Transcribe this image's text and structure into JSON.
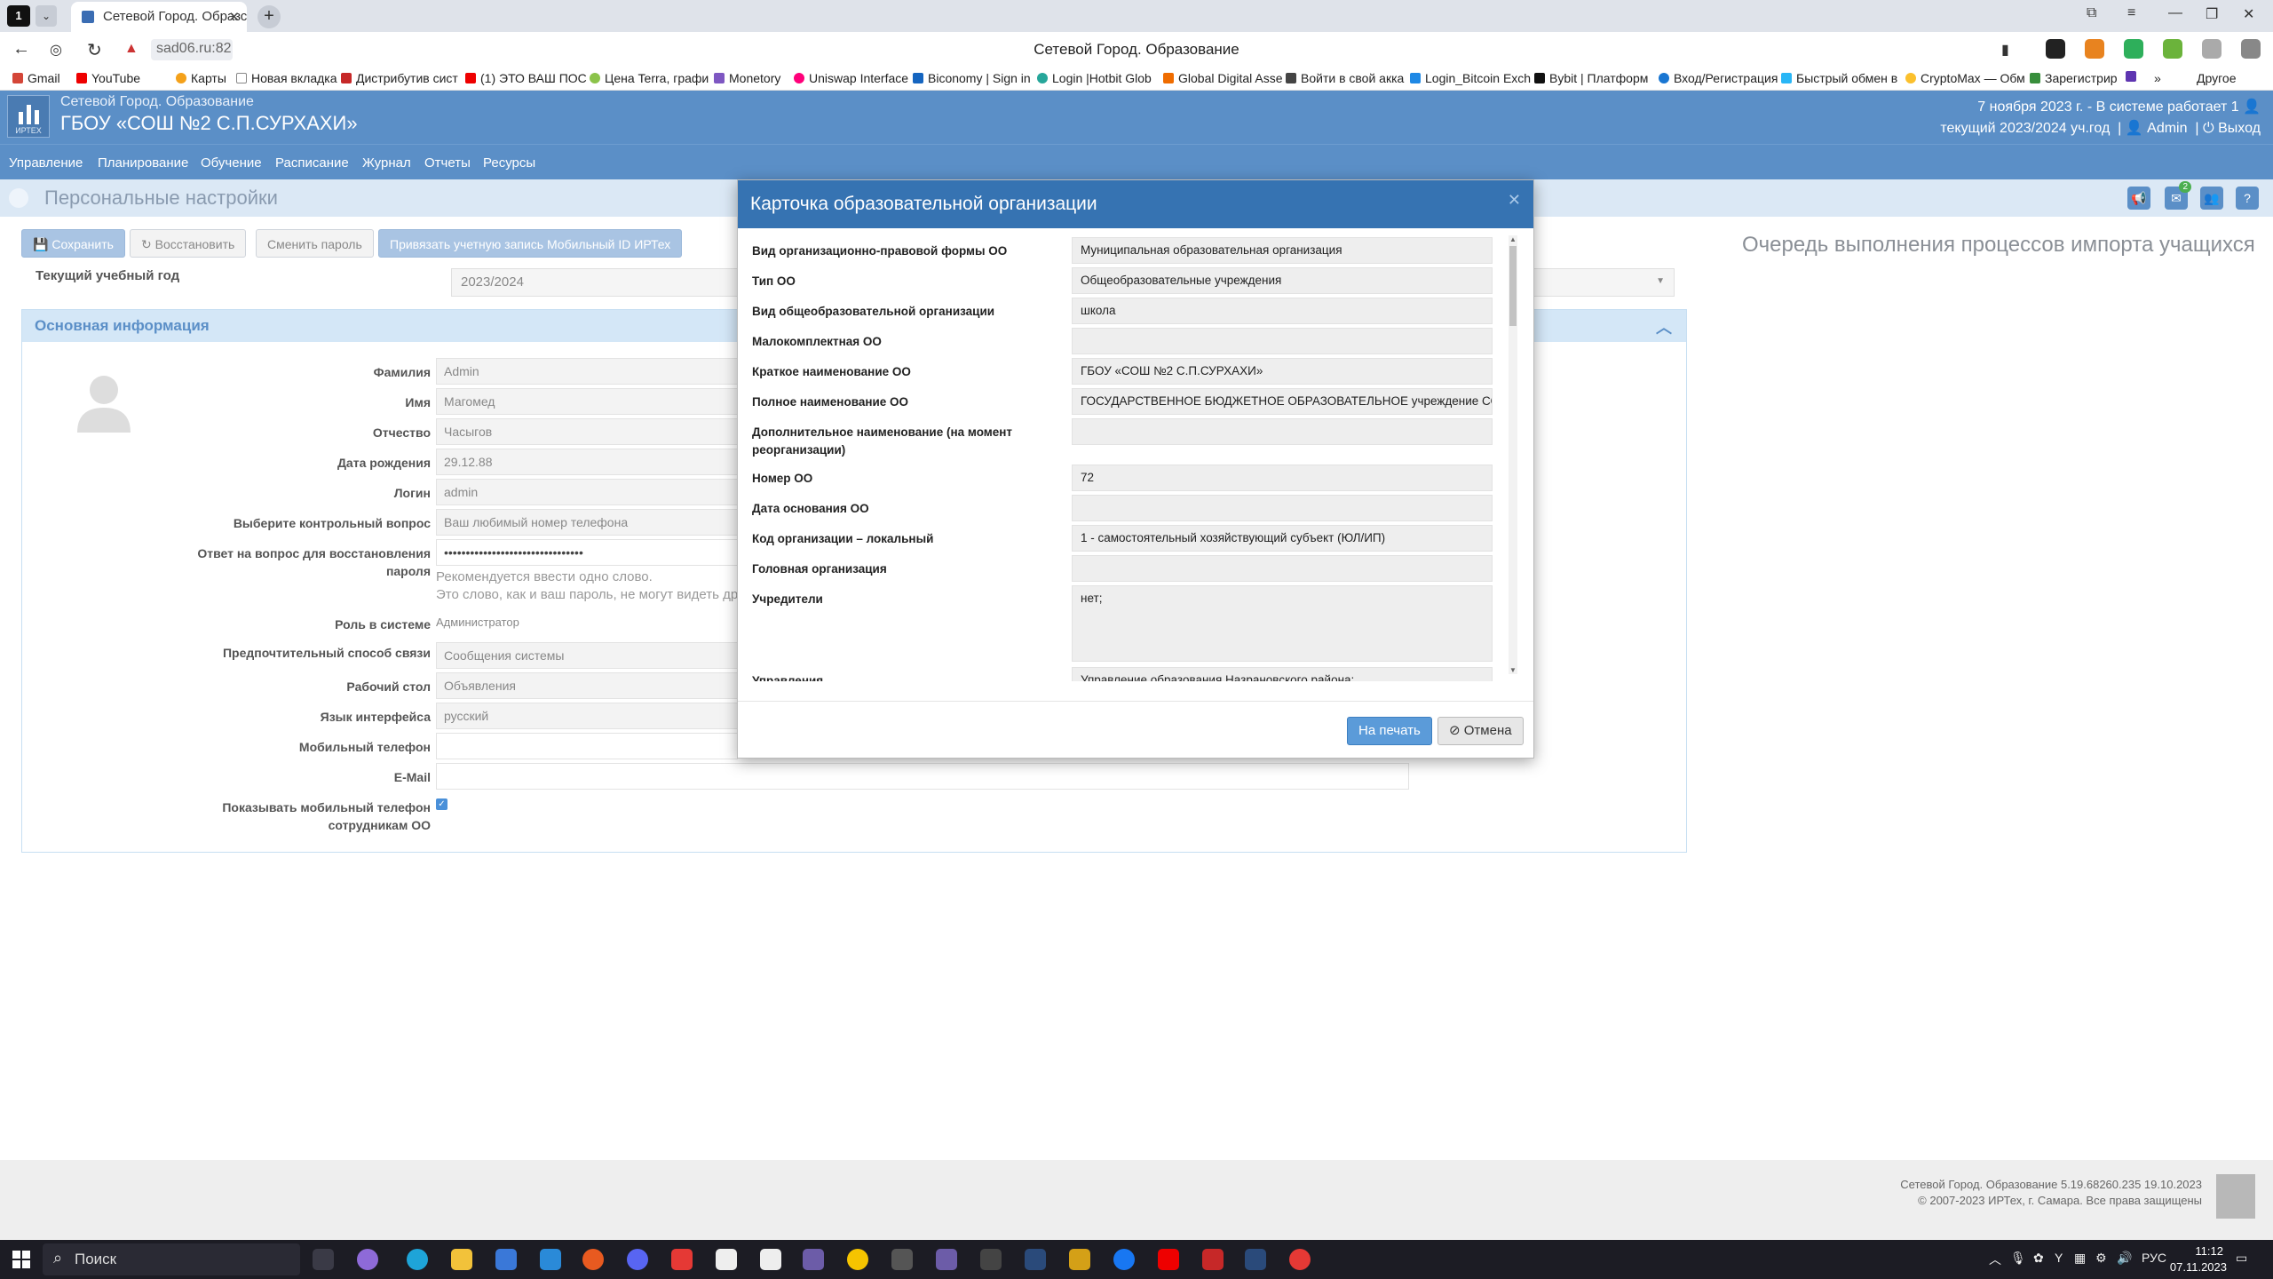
{
  "browser": {
    "tab_count": "1",
    "tab_title": "Сетевой Город. Образс",
    "url": "sad06.ru:82",
    "window_title": "Сетевой Город. Образование",
    "bookmarks": [
      "Gmail",
      "YouTube",
      "Карты",
      "Новая вкладка",
      "Дистрибутив сист",
      "(1) ЭТО ВАШ ПОС",
      "Цена Terra, графи",
      "Monetory",
      "Uniswap Interface",
      "Biconomy | Sign in",
      "Login |Hotbit Glob",
      "Global Digital Asse",
      "Войти в свой акка",
      "Login_Bitcoin Exch",
      "Bybit | Платформ",
      "Вход/Регистрация",
      "Быстрый обмен в",
      "CryptoMax — Обм",
      "Зарегистрир",
      "Другое"
    ],
    "more_bookmarks": "»"
  },
  "app": {
    "subtitle": "Сетевой Город. Образование",
    "org_name": "ГБОУ «СОШ №2 С.П.СУРХАХИ»",
    "date_info": "7 ноября 2023 г. - В системе работает 1",
    "year_info": "текущий 2023/2024 уч.год",
    "user": "Admin",
    "logout": "Выход",
    "logo_text": "ИРТЕХ"
  },
  "menu": [
    "Управление",
    "Планирование",
    "Обучение",
    "Расписание",
    "Журнал",
    "Отчеты",
    "Ресурсы"
  ],
  "page": {
    "title": "Персональные настройки",
    "mail_badge": "2",
    "buttons": {
      "save": "Сохранить",
      "restore": "Восстановить",
      "change_password": "Сменить пароль",
      "link_account": "Привязать учетную запись Мобильный ID ИРТех"
    },
    "year_label": "Текущий учебный год",
    "year_value": "2023/2024",
    "queue_title": "Очередь выполнения процессов импорта учащихся"
  },
  "panel": {
    "title": "Основная информация",
    "fields": [
      {
        "label": "Фамилия",
        "value": "Admin"
      },
      {
        "label": "Имя",
        "value": "Магомед"
      },
      {
        "label": "Отчество",
        "value": "Часыгов"
      },
      {
        "label": "Дата рождения",
        "value": "29.12.88"
      },
      {
        "label": "Логин",
        "value": "admin"
      },
      {
        "label": "Выберите контрольный вопрос",
        "value": "Ваш любимый номер телефона"
      },
      {
        "label": "Ответ на вопрос для восстановления пароля",
        "value": "••••••••••••••••••••••••••••••••"
      }
    ],
    "hint1": "Рекомендуется ввести одно слово.",
    "hint2": "Это слово, как и ваш пароль, не могут видеть др",
    "role_label": "Роль в системе",
    "role_value": "Администратор",
    "contact_label": "Предпочтительный способ связи",
    "contact_value": "Сообщения системы",
    "desktop_label": "Рабочий стол",
    "desktop_value": "Объявления",
    "lang_label": "Язык интерфейса",
    "lang_value": "русский",
    "mobile_label": "Мобильный телефон",
    "mobile_value": "",
    "email_label": "E-Mail",
    "email_value": "",
    "show_mobile_label": "Показывать мобильный телефон сотрудникам ОО"
  },
  "modal": {
    "title": "Карточка образовательной организации",
    "rows": [
      {
        "label": "Вид организационно-правовой формы ОО",
        "value": "Муниципальная образовательная организация"
      },
      {
        "label": "Тип ОО",
        "value": "Общеобразовательные учреждения"
      },
      {
        "label": "Вид общеобразовательной организации",
        "value": "школа"
      },
      {
        "label": "Малокомплектная ОО",
        "value": ""
      },
      {
        "label": "Краткое наименование ОО",
        "value": "ГБОУ «СОШ №2 С.П.СУРХАХИ»"
      },
      {
        "label": "Полное наименование ОО",
        "value": "ГОСУДАРСТВЕННОЕ БЮДЖЕТНОЕ ОБРАЗОВАТЕЛЬНОЕ учреждение СОШ"
      },
      {
        "label": "Дополнительное наименование (на момент реорганизации)",
        "value": ""
      },
      {
        "label": "Номер ОО",
        "value": "72"
      },
      {
        "label": "Дата основания ОО",
        "value": ""
      },
      {
        "label": "Код организации – локальный",
        "value": "1 - самостоятельный хозяйствующий субъект (ЮЛ/ИП)"
      },
      {
        "label": "Головная организация",
        "value": ""
      },
      {
        "label": "Учредители",
        "value": "нет;"
      },
      {
        "label": "Управления",
        "value": "Управление образования Назрановского района;"
      }
    ],
    "print_button": "На печать",
    "cancel_button": "Отмена"
  },
  "footer": {
    "version": "Сетевой Город. Образование  5.19.68260.235  19.10.2023",
    "copyright": "© 2007-2023 ИРТех, г. Самара. Все права защищены"
  },
  "taskbar": {
    "search": "Поиск",
    "lang": "РУС",
    "time": "11:12",
    "date": "07.11.2023"
  }
}
